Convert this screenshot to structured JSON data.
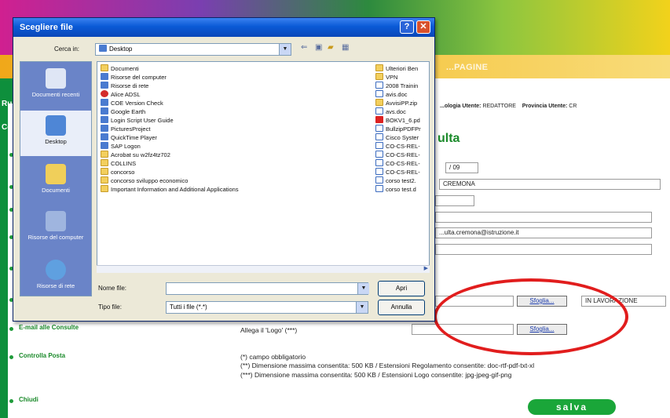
{
  "web": {
    "banner_text": "...PAGINE",
    "header_info": {
      "tipologia_label": "...ologia Utente:",
      "tipologia_value": "REDATTORE",
      "provincia_label": "Provincia Utente:",
      "provincia_value": "CR"
    },
    "page_title": "ulta",
    "sidebar_edge": [
      "Ru",
      "Co"
    ],
    "sidebar_items": [
      "E-mail alle Consulte",
      "Controlla Posta",
      "Chiudi"
    ],
    "fields": {
      "date_year": "/ 09",
      "city": "CREMONA",
      "email": "...ulta.cremona@istruzione.it",
      "stato": "IN LAVORAZIONE"
    },
    "allega_logo_label": "Allega il 'Logo' (***)",
    "sfoglia_label": "Sfoglia...",
    "notes": [
      "(*) campo obbligatorio",
      "(**) Dimensione massima consentita: 500 KB / Estensioni Regolamento consentite: doc-rtf-pdf-txt-xl",
      "(***) Dimensione massima consentita: 500 KB / Estensioni Logo consentite: jpg-jpeg-gif-png"
    ],
    "save_label": "salva"
  },
  "dialog": {
    "title": "Scegliere file",
    "help_glyph": "?",
    "close_glyph": "✕",
    "look_in_label": "Cerca in:",
    "look_in_value": "Desktop",
    "places": [
      "Documenti recenti",
      "Desktop",
      "Documenti",
      "Risorse del computer",
      "Risorse di rete"
    ],
    "files_left": [
      {
        "name": "Documenti",
        "icon": "folder-icon"
      },
      {
        "name": "Risorse del computer",
        "icon": "computer-icon"
      },
      {
        "name": "Risorse di rete",
        "icon": "network-icon"
      },
      {
        "name": "Alice ADSL",
        "icon": "app-icon"
      },
      {
        "name": "COE Version Check",
        "icon": "app-icon"
      },
      {
        "name": "Google Earth",
        "icon": "app-icon"
      },
      {
        "name": "Login Script User Guide",
        "icon": "app-icon"
      },
      {
        "name": "PicturesProject",
        "icon": "app-icon"
      },
      {
        "name": "QuickTime Player",
        "icon": "app-icon"
      },
      {
        "name": "SAP Logon",
        "icon": "app-icon"
      },
      {
        "name": "Acrobat su w2fz4tz702",
        "icon": "folder-icon"
      },
      {
        "name": "COLLINS",
        "icon": "folder-icon"
      },
      {
        "name": "concorso",
        "icon": "folder-icon"
      },
      {
        "name": "concorso sviluppo economico",
        "icon": "folder-icon"
      },
      {
        "name": "Important Information and Additional Applications",
        "icon": "folder-icon"
      }
    ],
    "files_right": [
      {
        "name": "Ulteriori Ben",
        "icon": "folder-icon"
      },
      {
        "name": "VPN",
        "icon": "folder-icon"
      },
      {
        "name": "2008 Trainin",
        "icon": "doc-icon"
      },
      {
        "name": "avis.doc",
        "icon": "doc-icon"
      },
      {
        "name": "AvvisiPP.zip",
        "icon": "zip-icon"
      },
      {
        "name": "avs.doc",
        "icon": "doc-icon"
      },
      {
        "name": "BOKV1_6.pd",
        "icon": "pdf-icon"
      },
      {
        "name": "BullzipPDFPr",
        "icon": "doc-icon"
      },
      {
        "name": "Cisco Syster",
        "icon": "doc-icon"
      },
      {
        "name": "CO-CS-REL-",
        "icon": "doc-icon"
      },
      {
        "name": "CO-CS-REL-",
        "icon": "doc-icon"
      },
      {
        "name": "CO-CS-REL-",
        "icon": "doc-icon"
      },
      {
        "name": "CO-CS-REL-",
        "icon": "doc-icon"
      },
      {
        "name": "corso test2.",
        "icon": "doc-icon"
      },
      {
        "name": "corso test.d",
        "icon": "doc-icon"
      }
    ],
    "filename_label": "Nome file:",
    "filename_value": "",
    "filetype_label": "Tipo file:",
    "filetype_value": "Tutti i file (*.*)",
    "open_label": "Apri",
    "cancel_label": "Annulla"
  },
  "colors": {
    "title_bar": "#0a5ad6",
    "dialog_bg": "#ece9d8",
    "sidebar_green": "#0e8f3c",
    "save_green": "#1aa639",
    "highlight_red": "#e11d1d"
  }
}
